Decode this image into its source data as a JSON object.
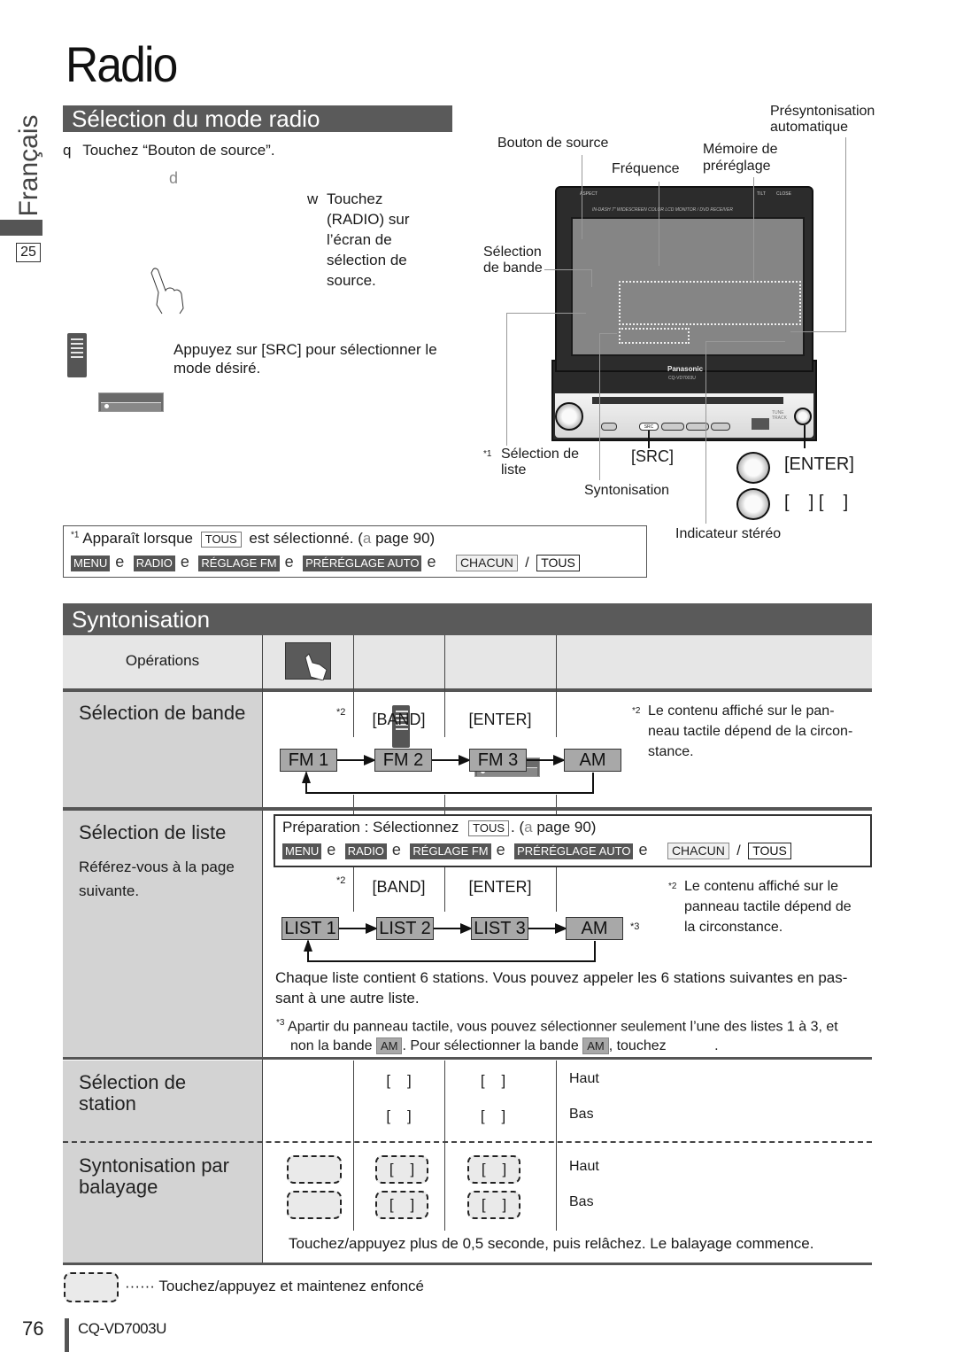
{
  "page": {
    "title": "Radio",
    "language_tab": "Français",
    "language_page": "25",
    "page_number": "76",
    "model": "CQ-VD7003U"
  },
  "mode_section": {
    "header": "Sélection du mode radio",
    "step_q_marker": "q",
    "step_q": "Touchez “Bouton de source”.",
    "arrow_glyph": "d",
    "step_w_marker": "w",
    "step_w_lines": [
      "Touchez",
      "(RADIO) sur",
      "l’écran de",
      "sélection de",
      "source."
    ],
    "src_instruction_line1": "Appuyez sur [SRC] pour sélectionner le",
    "src_instruction_line2": "mode désiré."
  },
  "device": {
    "labels": {
      "bouton_source": "Bouton de source",
      "frequence": "Fréquence",
      "memoire_line1": "Mémoire de",
      "memoire_line2": "préréglage",
      "presynto_line1": "Présyntonisation",
      "presynto_line2": "automatique",
      "selection_bande_line1": "Sélection",
      "selection_bande_line2": "de bande",
      "selection_liste_marker": "*1",
      "selection_liste_line1": "Sélection de",
      "selection_liste_line2": "liste",
      "src": "[SRC]",
      "syntonisation": "Syntonisation",
      "enter": "[ENTER]",
      "brackets": "[    ] [    ]",
      "indicateur_stereo": "Indicateur stéréo"
    },
    "printed": {
      "caption": "IN-DASH 7\" WIDESCREEN COLOR LCD MONITOR / DVD RECEIVER",
      "aspect": "ASPECT",
      "tilt": "TILT",
      "close": "CLOSE",
      "brand": "Panasonic",
      "model": "CQ-VD7003U",
      "src_btn": "SRC",
      "tune_track": "TUNE TRACK",
      "enter_knob": "ENTER"
    }
  },
  "note_box": {
    "marker": "*1",
    "text_before": "Apparaît lorsque",
    "tous": "TOUS",
    "text_after": "est sélectionné. (",
    "ref_glyph": "a",
    "page_ref": "page 90)",
    "path": [
      "MENU",
      "RADIO",
      "RÉGLAGE FM",
      "PRÉRÉGLAGE AUTO"
    ],
    "sep": "e",
    "option_a": "CHACUN",
    "slash": "/",
    "option_b": "TOUS"
  },
  "tuning": {
    "header": "Syntonisation",
    "operations_label": "Opérations",
    "band_selection": {
      "title": "Sélection de bande",
      "marker": "*2",
      "remote_key": "[BAND]",
      "unit_key": "[ENTER]",
      "cycle": [
        "FM 1",
        "FM 2",
        "FM 3",
        "AM"
      ],
      "note_marker": "*2",
      "note_lines": [
        "Le contenu affiché sur le pan-",
        "neau tactile dépend de la circon-",
        "stance."
      ]
    },
    "list_selection": {
      "title": "Sélection de liste",
      "ref_line1": "Référez-vous à la page",
      "ref_line2": "suivante.",
      "prep_text": "Préparation : Sélectionnez",
      "prep_tous": "TOUS",
      "prep_after": ". (",
      "prep_ref_glyph": "a",
      "prep_page": "page 90)",
      "path": [
        "MENU",
        "RADIO",
        "RÉGLAGE FM",
        "PRÉRÉGLAGE AUTO"
      ],
      "sep": "e",
      "option_a": "CHACUN",
      "slash": "/",
      "option_b": "TOUS",
      "marker": "*2",
      "remote_key": "[BAND]",
      "unit_key": "[ENTER]",
      "cycle": [
        "LIST 1",
        "LIST 2",
        "LIST 3",
        "AM"
      ],
      "am_marker": "*3",
      "note_marker": "*2",
      "note_lines": [
        "Le contenu affiché sur le",
        "panneau tactile dépend de",
        "la circonstance."
      ],
      "info_line1": "Chaque liste contient 6 stations. Vous pouvez appeler les 6 stations suivantes en pas-",
      "info_line2": "sant à une autre liste.",
      "foot_marker": "*3",
      "foot_line1": "Apartir du panneau tactile, vous pouvez sélectionner seulement l’une des listes 1 à 3, et",
      "foot_line2_a": "non la bande",
      "foot_am": "AM",
      "foot_line2_b": ". Pour sélectionner la bande",
      "foot_line2_c": ", touchez",
      "foot_end": "."
    },
    "station_selection": {
      "title_line1": "Sélection de",
      "title_line2": "station",
      "up_bracket": "[    ]",
      "down_bracket": "[    ]",
      "up_label": "Haut",
      "down_label": "Bas"
    },
    "seek_tuning": {
      "title_line1": "Syntonisation par",
      "title_line2": "balayage",
      "up_bracket": "[    ]",
      "down_bracket": "[    ]",
      "up_label": "Haut",
      "down_label": "Bas",
      "note": "Touchez/appuyez plus de 0,5 seconde, puis relâchez. Le balayage commence."
    }
  },
  "legend": {
    "dots": "······",
    "text": "Touchez/appuyez et maintenez enfoncé"
  }
}
